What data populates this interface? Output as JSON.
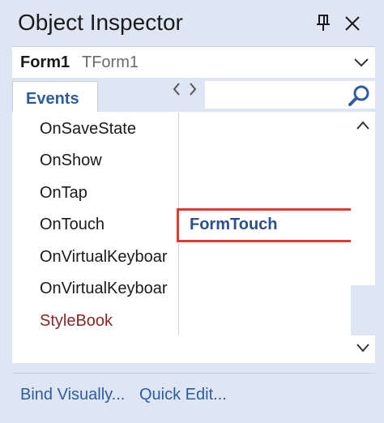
{
  "window": {
    "title": "Object Inspector"
  },
  "object_selector": {
    "name": "Form1",
    "type": "TForm1"
  },
  "tabs": [
    {
      "label": "Events",
      "selected": true
    }
  ],
  "search": {
    "value": ""
  },
  "events": [
    {
      "name": "OnSaveState",
      "value": ""
    },
    {
      "name": "OnShow",
      "value": ""
    },
    {
      "name": "OnTap",
      "value": ""
    },
    {
      "name": "OnTouch",
      "value": "FormTouch"
    },
    {
      "name": "OnVirtualKeyboardHidden",
      "display": "OnVirtualKeyboar",
      "value": ""
    },
    {
      "name": "OnVirtualKeyboardShown",
      "display": "OnVirtualKeyboar",
      "value": ""
    },
    {
      "name": "StyleBook",
      "value": ""
    }
  ],
  "footer": {
    "bind_visually": "Bind Visually...",
    "quick_edit": "Quick Edit..."
  },
  "colors": {
    "accent": "#2e5c9e",
    "highlight_border": "#e03a2e",
    "special_property": "#8b2525",
    "panel_bg": "#dfe6f3"
  },
  "icons": [
    "pin-icon",
    "close-icon",
    "chevron-down-icon",
    "chevron-left-icon",
    "chevron-right-icon",
    "search-icon",
    "scroll-up-icon",
    "scroll-down-icon"
  ]
}
